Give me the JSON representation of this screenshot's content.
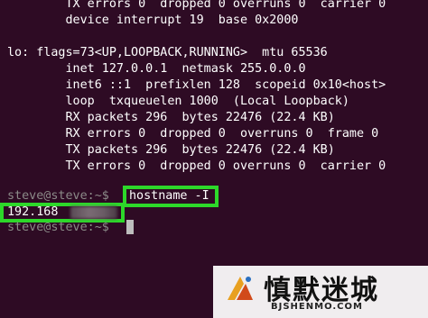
{
  "terminal": {
    "lines": [
      "        TX errors 0  dropped 0 overruns 0  carrier 0",
      "        device interrupt 19  base 0x2000",
      "",
      "lo: flags=73<UP,LOOPBACK,RUNNING>  mtu 65536",
      "        inet 127.0.0.1  netmask 255.0.0.0",
      "        inet6 ::1  prefixlen 128  scopeid 0x10<host>",
      "        loop  txqueuelen 1000  (Local Loopback)",
      "        RX packets 296  bytes 22476 (22.4 KB)",
      "        RX errors 0  dropped 0  overruns 0  frame 0",
      "        TX packets 296  bytes 22476 (22.4 KB)",
      "        TX errors 0  dropped 0 overruns 0  carrier 0"
    ],
    "prompt": "steve@steve:~$ ",
    "command": "hostname -I",
    "ip_visible": "192.168",
    "prompt_after": "steve@steve:~$ "
  },
  "watermark": {
    "title": "慎默迷城",
    "subtitle": "BJSHENMO.COM"
  },
  "colors": {
    "background": "#2e0b24",
    "highlight": "#2dd82a",
    "text": "#ffffff",
    "prompt": "#8b8a88"
  }
}
